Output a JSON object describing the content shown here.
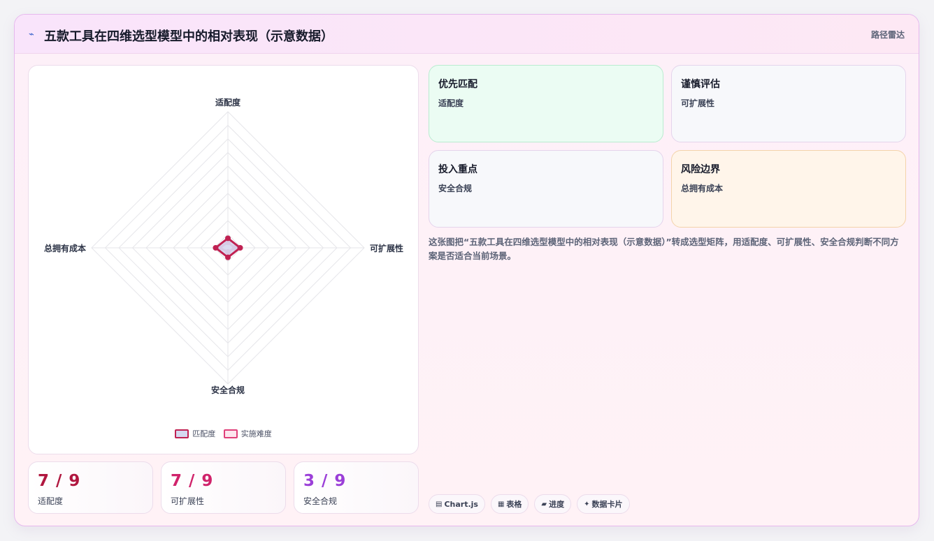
{
  "header": {
    "icon": "chart-line-icon",
    "title": "五款工具在四维选型模型中的相对表现（示意数据）",
    "tag": "路径雷达"
  },
  "chart_data": {
    "type": "radar",
    "title": "",
    "axes": [
      "适配度",
      "可扩展性",
      "安全合规",
      "总拥有成本"
    ],
    "scale": {
      "min": 0,
      "max": 10,
      "rings": 10
    },
    "series": [
      {
        "name": "匹配度",
        "values": [
          0.7,
          0.9,
          0.7,
          0.9
        ],
        "color": "#c02152",
        "fill": "#d6d8f0"
      },
      {
        "name": "实施难度",
        "values": [
          0.4,
          0.5,
          0.3,
          0.6
        ],
        "color": "#e0407a",
        "fill": "#fde5ee"
      }
    ],
    "legend_position": "bottom"
  },
  "stats": [
    {
      "value": "7 / 9",
      "label": "适配度",
      "color": "#b0173f"
    },
    {
      "value": "7 / 9",
      "label": "可扩展性",
      "color": "#d0236b"
    },
    {
      "value": "3 / 9",
      "label": "安全合规",
      "color": "#9b3fd8"
    }
  ],
  "quadrants": [
    {
      "title": "优先匹配",
      "sub": "适配度",
      "bg": "#ebfcf3",
      "border": "#b9ecd0"
    },
    {
      "title": "谨慎评估",
      "sub": "可扩展性",
      "bg": "#f7f8fb",
      "border": "#e4d4ec"
    },
    {
      "title": "投入重点",
      "sub": "安全合规",
      "bg": "#f7f8fb",
      "border": "#e4d4ec"
    },
    {
      "title": "风险边界",
      "sub": "总拥有成本",
      "bg": "#fff5ea",
      "border": "#f4d3aa"
    }
  ],
  "description": "这张图把“五款工具在四维选型模型中的相对表现（示意数据）”转成选型矩阵，用适配度、可扩展性、安全合规判断不同方案是否适合当前场景。",
  "chips": [
    {
      "icon": "▤",
      "label": "Chart.js"
    },
    {
      "icon": "▦",
      "label": "表格"
    },
    {
      "icon": "▰",
      "label": "进度"
    },
    {
      "icon": "✦",
      "label": "数据卡片"
    }
  ]
}
